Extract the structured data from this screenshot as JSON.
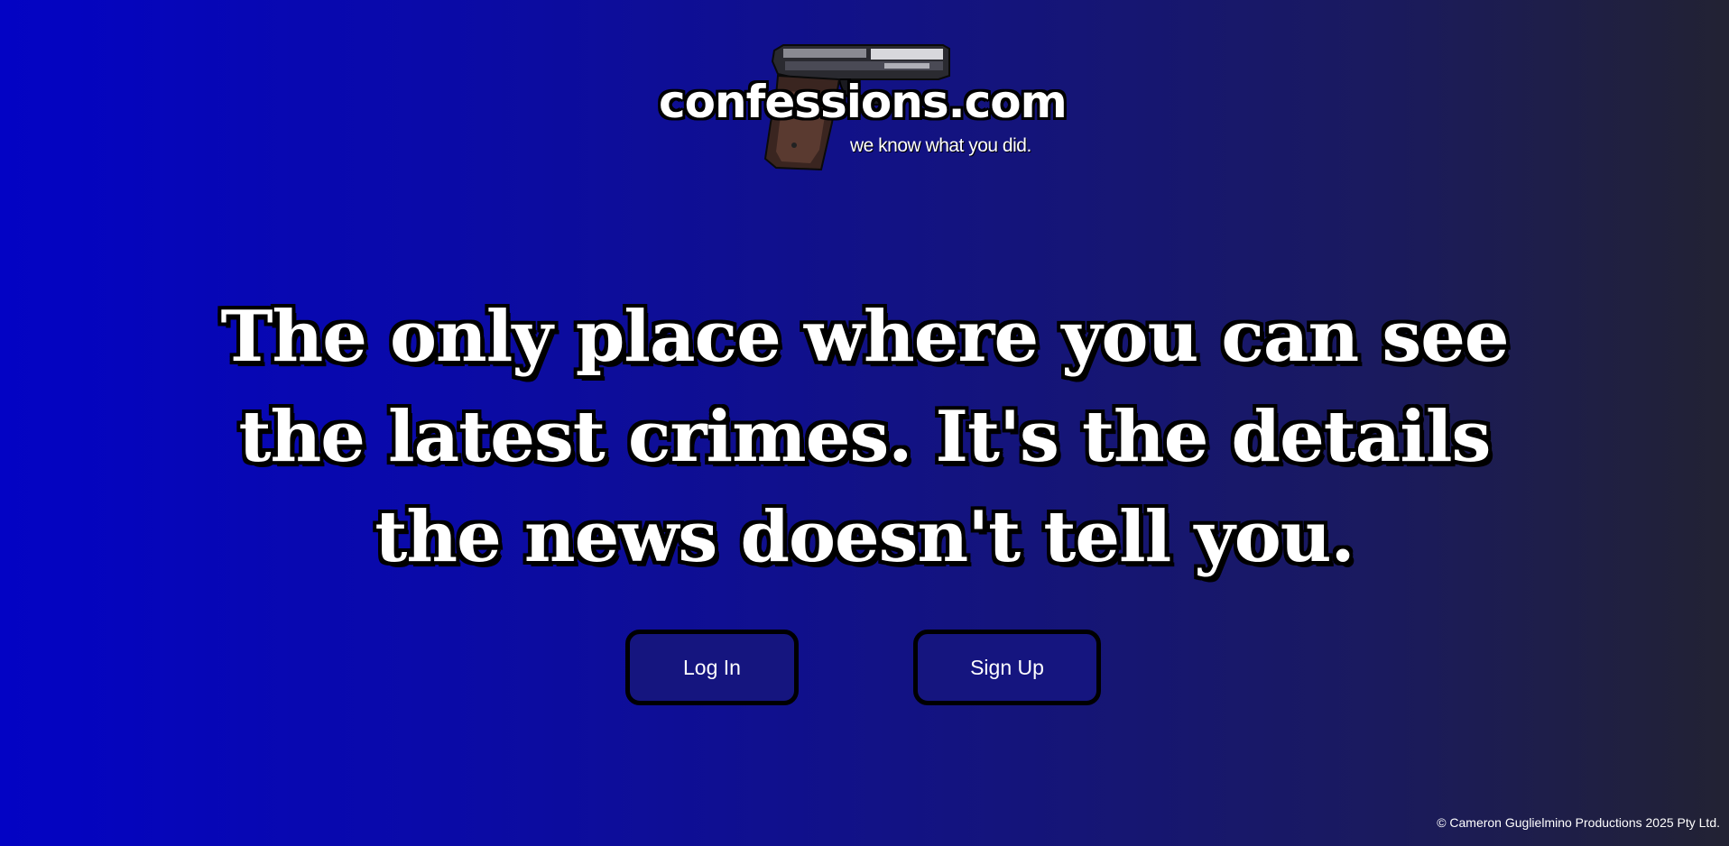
{
  "brand": {
    "title": "confessions.com",
    "tagline": "we know what you did."
  },
  "hero": {
    "headline": "The only place where you can see the latest crimes. It's the details the news doesn't tell you."
  },
  "actions": {
    "login_label": "Log In",
    "signup_label": "Sign Up"
  },
  "footer": {
    "copyright": "© Cameron Guglielmino Productions 2025 Pty Ltd."
  },
  "icons": {
    "logo_image": "pistol-icon"
  },
  "colors": {
    "background_start": "#0303c4",
    "background_end": "#222233",
    "button_fill": "#15157f",
    "button_border": "#000000",
    "text": "#ffffff"
  }
}
